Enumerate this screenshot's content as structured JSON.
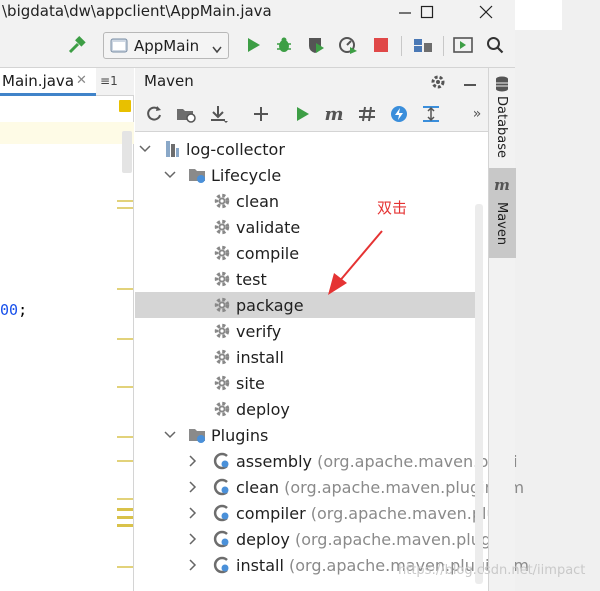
{
  "window": {
    "title": "\\bigdata\\dw\\appclient\\AppMain.java"
  },
  "toolbar": {
    "run_config": "AppMain"
  },
  "editor": {
    "tab_label": "Main.java",
    "tab_list_count": "1",
    "code_fragment": "00",
    "code_semicolon": ";"
  },
  "maven": {
    "title": "Maven",
    "tree": {
      "root": "log-collector",
      "lifecycle": "Lifecycle",
      "lifecycle_items": [
        "clean",
        "validate",
        "compile",
        "test",
        "package",
        "verify",
        "install",
        "site",
        "deploy"
      ],
      "selected": "package",
      "plugins": "Plugins",
      "plugin_items": [
        {
          "name": "assembly",
          "group": "(org.apache.maven.plugi"
        },
        {
          "name": "clean",
          "group": "(org.apache.maven.plugins:m"
        },
        {
          "name": "compiler",
          "group": "(org.apache.maven.plugi"
        },
        {
          "name": "deploy",
          "group": "(org.apache.maven.plugins"
        },
        {
          "name": "install",
          "group": "(org.apache.maven.plugins:m"
        }
      ]
    }
  },
  "side_panel": {
    "database": "Database",
    "maven": "Maven"
  },
  "annotation": {
    "text": "双击",
    "color": "#e53333"
  },
  "watermark": "https://blog.csdn.net/iimpact",
  "colors": {
    "run_green": "#3d9e45",
    "stop_red": "#e04848",
    "selection": "#d5d5d5",
    "tab_underline": "#4083c9"
  }
}
